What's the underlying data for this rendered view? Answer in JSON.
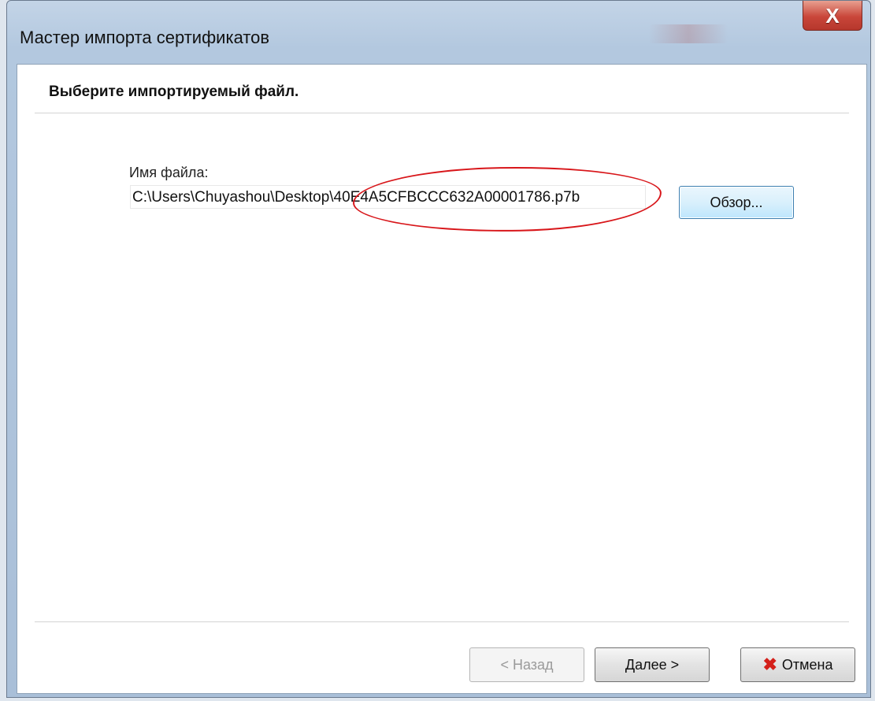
{
  "window": {
    "title": "Мастер импорта сертификатов",
    "close_glyph": "X"
  },
  "page": {
    "header": "Выберите импортируемый файл."
  },
  "file": {
    "label": "Имя файла:",
    "path_value": "C:\\Users\\Chuyashou\\Desktop\\40E4A5CFBCCC632A00001786.p7b",
    "browse_label": "Обзор..."
  },
  "footer": {
    "back_label": "< Назад",
    "next_label": "Далее >",
    "cancel_label": "Отмена",
    "cancel_icon": "cross-icon"
  },
  "colors": {
    "annotation": "#d8161a",
    "close_button": "#c9463a",
    "cancel_icon": "#d4201a"
  }
}
